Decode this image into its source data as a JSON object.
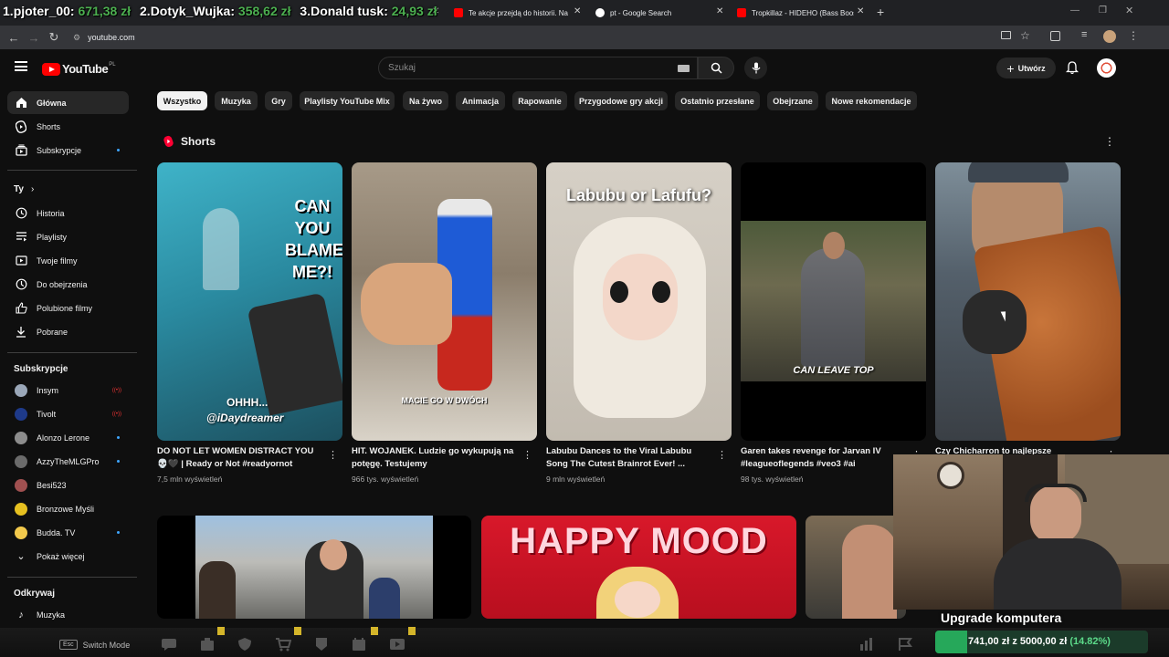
{
  "stream_overlay": {
    "entries": [
      {
        "rank": "1.",
        "name": "pjoter_00:",
        "amount": "671,38 zł"
      },
      {
        "rank": "2.",
        "name": "Dotyk_Wujka:",
        "amount": "358,62 zł"
      },
      {
        "rank": "3.",
        "name": "Donald tusk:",
        "amount": "24,93 zł"
      }
    ]
  },
  "browser": {
    "tabs": [
      {
        "title": "Te akcje przejdą do historii. Na",
        "icon_color": "#ff0000"
      },
      {
        "title": "pt - Google Search",
        "icon_color": "#4285f4"
      },
      {
        "title": "Tropkillaz - HIDEHO (Bass Boos",
        "icon_color": "#ff0000"
      }
    ],
    "new_tab": "+",
    "url": "youtube.com"
  },
  "youtube": {
    "logo_text": "YouTube",
    "logo_region": "PL",
    "search_placeholder": "Szukaj",
    "create_label": "Utwórz"
  },
  "sidebar": {
    "main": [
      {
        "label": "Główna",
        "icon": "home-icon",
        "active": true
      },
      {
        "label": "Shorts",
        "icon": "shorts-icon"
      },
      {
        "label": "Subskrypcje",
        "icon": "subscriptions-icon",
        "dot": true
      }
    ],
    "you_header": "Ty",
    "you": [
      {
        "label": "Historia",
        "icon": "history-icon"
      },
      {
        "label": "Playlisty",
        "icon": "playlist-icon"
      },
      {
        "label": "Twoje filmy",
        "icon": "your-videos-icon"
      },
      {
        "label": "Do obejrzenia",
        "icon": "watch-later-icon"
      },
      {
        "label": "Polubione filmy",
        "icon": "like-icon"
      },
      {
        "label": "Pobrane",
        "icon": "download-icon"
      }
    ],
    "subs_header": "Subskrypcje",
    "subs": [
      {
        "label": "Insym",
        "color": "#9aa7b8",
        "status": "live"
      },
      {
        "label": "Tivolt",
        "color": "#1e3a8a",
        "status": "live"
      },
      {
        "label": "Alonzo Lerone",
        "color": "#8d8d8d",
        "status": "dot"
      },
      {
        "label": "AzzyTheMLGPro",
        "color": "#6b6b6b",
        "status": "dot"
      },
      {
        "label": "Besi523",
        "color": "#a05050",
        "status": ""
      },
      {
        "label": "Bronzowe Myśli",
        "color": "#e6c020",
        "status": ""
      },
      {
        "label": "Budda. TV",
        "color": "#f2c94c",
        "status": "dot"
      }
    ],
    "show_more": "Pokaż więcej",
    "explore_header": "Odkrywaj",
    "explore": [
      {
        "label": "Muzyka",
        "icon": "music-icon"
      }
    ]
  },
  "chips": [
    "Wszystko",
    "Muzyka",
    "Gry",
    "Playlisty YouTube Mix",
    "Na żywo",
    "Animacja",
    "Rapowanie",
    "Przygodowe gry akcji",
    "Ostatnio przesłane",
    "Obejrzane",
    "Nowe rekomendacje"
  ],
  "shorts_header": "Shorts",
  "shorts": [
    {
      "title": "DO NOT LET WOMEN DISTRACT YOU 💀🖤 | Ready or Not #readyornot",
      "views": "7,5 mln wyświetleń",
      "overlay": "CAN YOU BLAME ME?!",
      "overlay2": "OHHH...",
      "overlay3": "@iDaydreamer"
    },
    {
      "title": "HIT. WOJANEK. Ludzie go wykupują na potęgę. Testujemy",
      "views": "966 tys. wyświetleń",
      "overlay": "MACIE GO W DWÓCH"
    },
    {
      "title": "Labubu Dances to the Viral Labubu Song The Cutest Brainrot Ever! ...",
      "views": "9 mln wyświetleń",
      "overlay": "Labubu or Lafufu?"
    },
    {
      "title": "Garen takes revenge for Jarvan IV #leagueoflegends #veo3 #ai",
      "views": "98 tys. wyświetleń",
      "overlay": "CAN LEAVE TOP"
    },
    {
      "title": "Czy Chicharron to najlepsze",
      "views": ""
    }
  ],
  "bottom_thumbs": [
    {
      "text": ""
    },
    {
      "text": "HAPPY MOOD"
    },
    {
      "text": ""
    }
  ],
  "webcam_caption": "Upgrade komputera",
  "taskbar": {
    "esc_key": "Esc",
    "esc_label": "Switch Mode"
  },
  "goal": {
    "text": "741,00 zł z 5000,00 zł",
    "percent_text": "(14.82%)",
    "fraction": 0.1482
  }
}
